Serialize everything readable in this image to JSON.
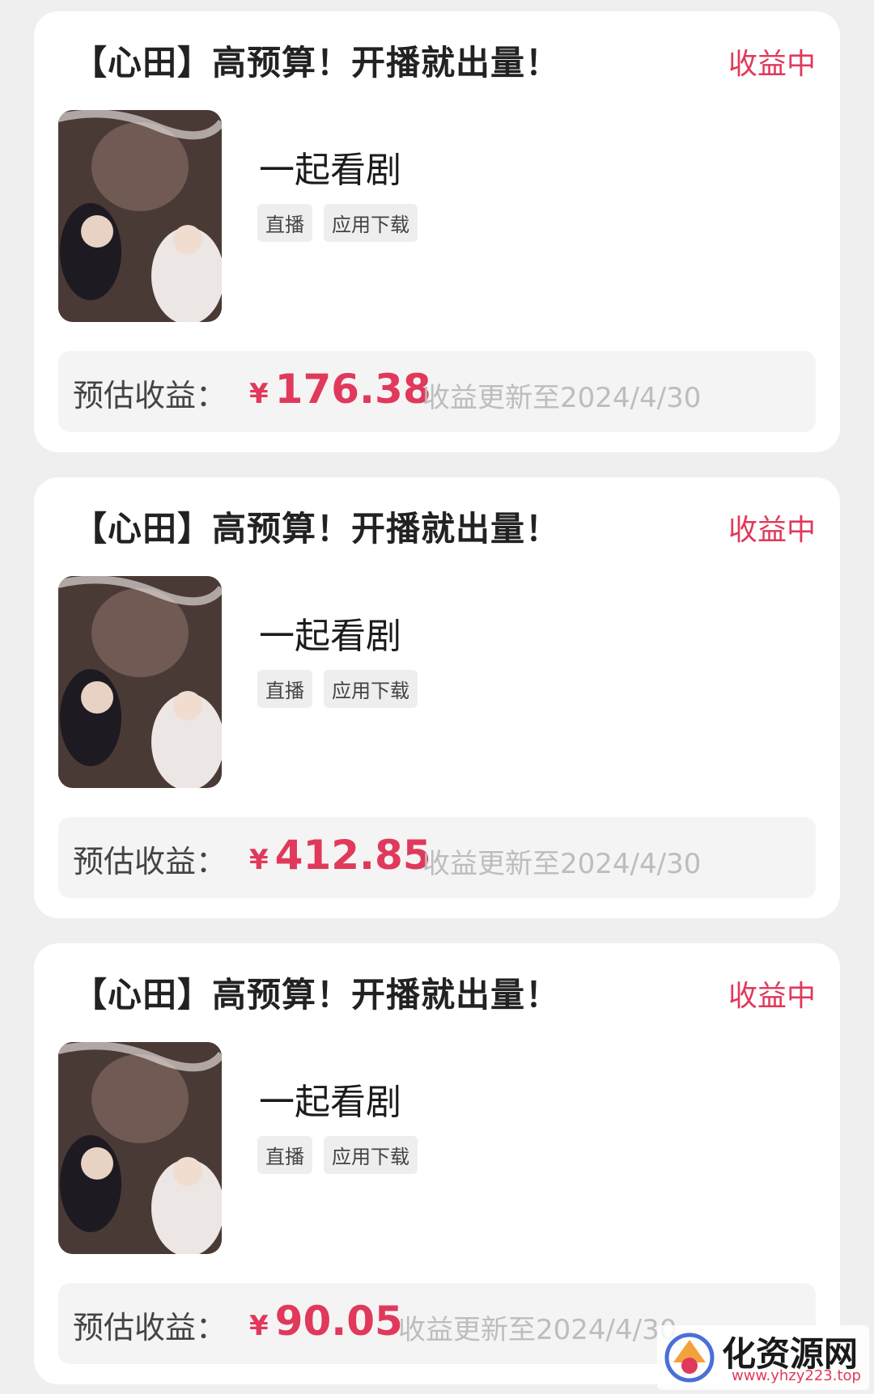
{
  "cards": [
    {
      "title": "【心田】高预算！开播就出量！",
      "status": "收益中",
      "app_name": "一起看剧",
      "tags": [
        "直播",
        "应用下载"
      ],
      "earnings_label": "预估收益：",
      "currency": "¥",
      "amount": "176.38",
      "update_text": "收益更新至2024/4/30"
    },
    {
      "title": "【心田】高预算！开播就出量！",
      "status": "收益中",
      "app_name": "一起看剧",
      "tags": [
        "直播",
        "应用下载"
      ],
      "earnings_label": "预估收益：",
      "currency": "¥",
      "amount": "412.85",
      "update_text": "收益更新至2024/4/30"
    },
    {
      "title": "【心田】高预算！开播就出量！",
      "status": "收益中",
      "app_name": "一起看剧",
      "tags": [
        "直播",
        "应用下载"
      ],
      "earnings_label": "预估收益：",
      "currency": "¥",
      "amount": "90.05",
      "update_text": "收益更新至2024/4/30"
    }
  ],
  "watermark": {
    "name": "化资源网",
    "url": "www.yhzy223.top",
    "icon": "logo-icon"
  },
  "colors": {
    "accent": "#e0395b",
    "background": "#efefef",
    "card": "#ffffff",
    "muted_text": "#bdbdbd"
  }
}
